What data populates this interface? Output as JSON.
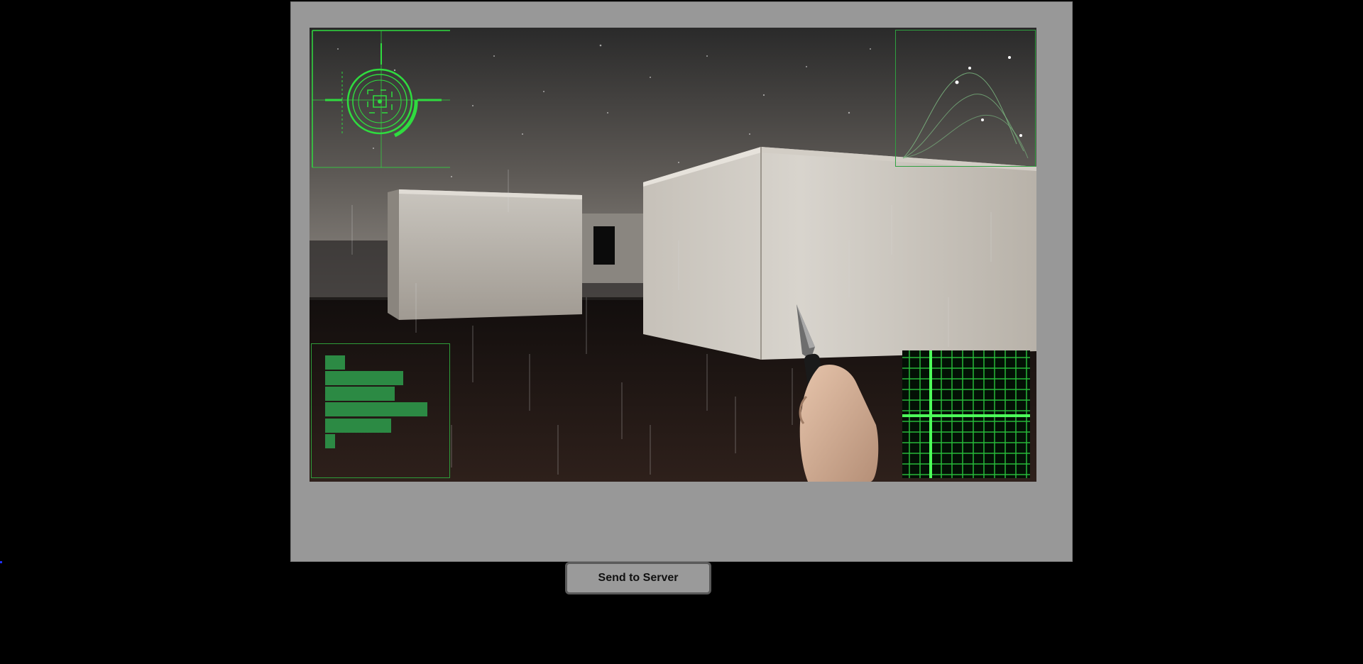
{
  "controls": {
    "send_label": "Send to Server"
  },
  "hud": {
    "status_bars": [
      0.16,
      0.63,
      0.56,
      0.82,
      0.53,
      0.08
    ],
    "accent_color": "#2fdc3f",
    "bar_color": "#2c8a44"
  },
  "scene": {
    "weather": "rain",
    "held_item": "knife"
  },
  "colors": {
    "page_background": "#000000",
    "stage_background": "#989898",
    "button_background": "#9a9a9a"
  }
}
